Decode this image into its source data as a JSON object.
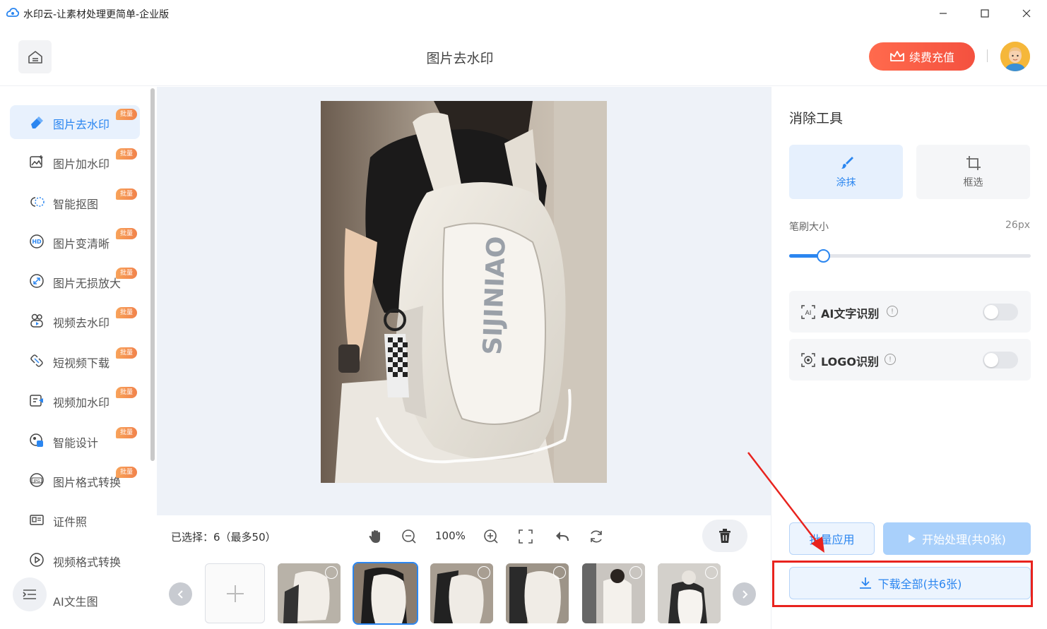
{
  "window": {
    "title": "水印云-让素材处理更简单-企业版",
    "controls": [
      "minimize",
      "maximize",
      "close"
    ]
  },
  "header": {
    "page_title": "图片去水印",
    "recharge_label": "续费充值"
  },
  "sidebar": {
    "items": [
      {
        "label": "图片去水印",
        "icon": "eraser-icon",
        "badge": "批量",
        "active": true
      },
      {
        "label": "图片加水印",
        "icon": "image-add-icon",
        "badge": "批量",
        "active": false
      },
      {
        "label": "智能抠图",
        "icon": "cutout-icon",
        "badge": "批量",
        "active": false
      },
      {
        "label": "图片变清晰",
        "icon": "hd-icon",
        "badge": "批量",
        "active": false
      },
      {
        "label": "图片无损放大",
        "icon": "enlarge-icon",
        "badge": "批量",
        "active": false
      },
      {
        "label": "视频去水印",
        "icon": "video-eraser-icon",
        "badge": "批量",
        "active": false
      },
      {
        "label": "短视频下载",
        "icon": "link-download-icon",
        "badge": "批量",
        "active": false
      },
      {
        "label": "视频加水印",
        "icon": "video-add-icon",
        "badge": "批量",
        "active": false
      },
      {
        "label": "智能设计",
        "icon": "design-icon",
        "badge": "批量",
        "active": false
      },
      {
        "label": "图片格式转换",
        "icon": "jpg-icon",
        "badge": "批量",
        "active": false
      },
      {
        "label": "证件照",
        "icon": "id-card-icon",
        "badge": "",
        "active": false
      },
      {
        "label": "视频格式转换",
        "icon": "play-circle-icon",
        "badge": "",
        "active": false
      },
      {
        "label": "AI文生图",
        "icon": "ai-image-icon",
        "badge": "",
        "active": false
      }
    ]
  },
  "toolbar": {
    "selection_text": "已选择：6（最多50）",
    "zoom": "100%"
  },
  "thumbnails": {
    "count": 6,
    "selected_index": 1
  },
  "right_panel": {
    "title": "消除工具",
    "tools": [
      {
        "label": "涂抹",
        "icon": "brush-icon",
        "active": true
      },
      {
        "label": "框选",
        "icon": "crop-icon",
        "active": false
      }
    ],
    "brush": {
      "label": "笔刷大小",
      "value_text": "26px",
      "fraction": 0.14
    },
    "options": [
      {
        "label": "AI文字识别",
        "icon": "ai-text-icon",
        "enabled": false
      },
      {
        "label": "LOGO识别",
        "icon": "logo-detect-icon",
        "enabled": false
      }
    ],
    "batch_apply_label": "批量应用",
    "start_label": "开始处理(共0张)",
    "download_label": "下载全部(共6张)"
  },
  "colors": {
    "accent": "#2b86f0",
    "recharge": "#f4513f",
    "badge": "#f1824b",
    "annotation": "#e8231e"
  }
}
